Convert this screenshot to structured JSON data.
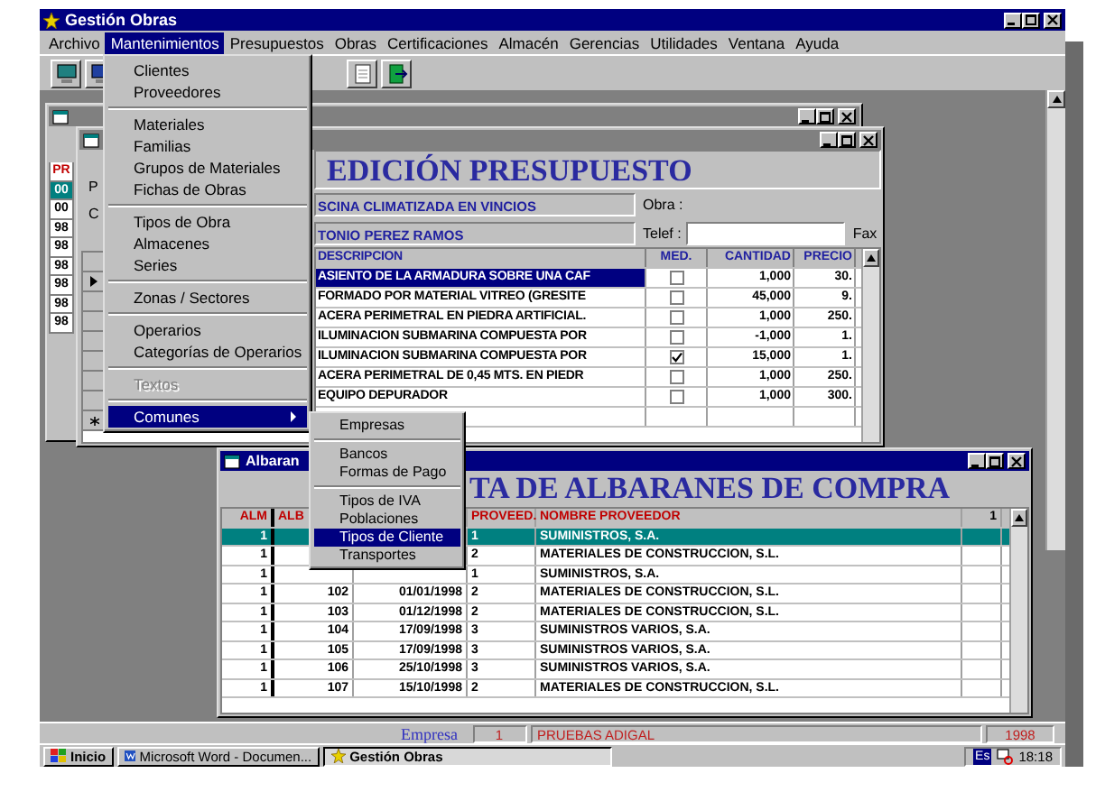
{
  "window": {
    "title": "Gestión Obras"
  },
  "menu_bar": [
    {
      "label": "Archivo",
      "selected": false
    },
    {
      "label": "Mantenimientos",
      "selected": true
    },
    {
      "label": "Presupuestos",
      "selected": false
    },
    {
      "label": "Obras",
      "selected": false
    },
    {
      "label": "Certificaciones",
      "selected": false
    },
    {
      "label": "Almacén",
      "selected": false
    },
    {
      "label": "Gerencias",
      "selected": false
    },
    {
      "label": "Utilidades",
      "selected": false
    },
    {
      "label": "Ventana",
      "selected": false
    },
    {
      "label": "Ayuda",
      "selected": false
    }
  ],
  "mantenimientos_menu": [
    {
      "kind": "item",
      "label": "Clientes",
      "disabled": false,
      "selected": false,
      "has_submenu": false
    },
    {
      "kind": "item",
      "label": "Proveedores",
      "disabled": false,
      "selected": false,
      "has_submenu": false
    },
    {
      "kind": "separator"
    },
    {
      "kind": "item",
      "label": "Materiales",
      "disabled": false,
      "selected": false,
      "has_submenu": false
    },
    {
      "kind": "item",
      "label": "Familias",
      "disabled": false,
      "selected": false,
      "has_submenu": false
    },
    {
      "kind": "item",
      "label": "Grupos de Materiales",
      "disabled": false,
      "selected": false,
      "has_submenu": false
    },
    {
      "kind": "item",
      "label": "Fichas de Obras",
      "disabled": false,
      "selected": false,
      "has_submenu": false
    },
    {
      "kind": "separator"
    },
    {
      "kind": "item",
      "label": "Tipos de Obra",
      "disabled": false,
      "selected": false,
      "has_submenu": false
    },
    {
      "kind": "item",
      "label": "Almacenes",
      "disabled": false,
      "selected": false,
      "has_submenu": false
    },
    {
      "kind": "item",
      "label": "Series",
      "disabled": false,
      "selected": false,
      "has_submenu": false
    },
    {
      "kind": "separator"
    },
    {
      "kind": "item",
      "label": "Zonas / Sectores",
      "disabled": false,
      "selected": false,
      "has_submenu": false
    },
    {
      "kind": "separator"
    },
    {
      "kind": "item",
      "label": "Operarios",
      "disabled": false,
      "selected": false,
      "has_submenu": false
    },
    {
      "kind": "item",
      "label": "Categorías de Operarios",
      "disabled": false,
      "selected": false,
      "has_submenu": false
    },
    {
      "kind": "separator"
    },
    {
      "kind": "item",
      "label": "Textos",
      "disabled": true,
      "selected": false,
      "has_submenu": false
    },
    {
      "kind": "separator"
    },
    {
      "kind": "item",
      "label": "Comunes",
      "disabled": false,
      "selected": true,
      "has_submenu": true
    }
  ],
  "comunes_submenu": [
    {
      "kind": "item",
      "label": "Empresas",
      "selected": false
    },
    {
      "kind": "separator"
    },
    {
      "kind": "item",
      "label": "Bancos",
      "selected": false
    },
    {
      "kind": "item",
      "label": "Formas de Pago",
      "selected": false
    },
    {
      "kind": "separator"
    },
    {
      "kind": "item",
      "label": "Tipos de IVA",
      "selected": false
    },
    {
      "kind": "item",
      "label": "Poblaciones",
      "selected": false
    },
    {
      "kind": "item",
      "label": "Tipos de Cliente",
      "selected": true
    },
    {
      "kind": "item",
      "label": "Transportes",
      "selected": false
    }
  ],
  "presupuestos_window": {
    "codes": [
      {
        "kind": "header",
        "text": "PR",
        "selected": false
      },
      {
        "kind": "code",
        "text": "00",
        "selected": true
      },
      {
        "kind": "code",
        "text": "00",
        "selected": false
      },
      {
        "kind": "code",
        "text": "98",
        "selected": false
      },
      {
        "kind": "code",
        "text": "98",
        "selected": false
      },
      {
        "kind": "code",
        "text": "98",
        "selected": false
      },
      {
        "kind": "code",
        "text": "98",
        "selected": false
      },
      {
        "kind": "code",
        "text": "98",
        "selected": false
      },
      {
        "kind": "code",
        "text": "98",
        "selected": false
      }
    ]
  },
  "edicion_window": {
    "heading": "EDICIÓN PRESUPUESTO",
    "labels": [
      "P",
      "C"
    ],
    "obra_value": "SCINA CLIMATIZADA EN VINCIOS",
    "obra_label": "Obra :",
    "cliente_value": "TONIO PEREZ RAMOS",
    "telef_label": "Telef :",
    "fax_label": "Fax",
    "record_selectors": [
      {
        "kind": "blank"
      },
      {
        "kind": "current"
      },
      {
        "kind": "blank"
      },
      {
        "kind": "blank"
      },
      {
        "kind": "blank"
      },
      {
        "kind": "blank"
      },
      {
        "kind": "blank"
      },
      {
        "kind": "blank"
      },
      {
        "kind": "new"
      }
    ],
    "table": {
      "columns": [
        "DESCRIPCION",
        "MED.",
        "CANTIDAD",
        "PRECIO"
      ],
      "rows": [
        {
          "descripcion": "ASIENTO DE LA ARMADURA SOBRE UNA CAF",
          "med": false,
          "cantidad": "1,000",
          "precio": "30.",
          "selected": true
        },
        {
          "descripcion": "FORMADO POR MATERIAL VITREO (GRESITE",
          "med": false,
          "cantidad": "45,000",
          "precio": "9.",
          "selected": false
        },
        {
          "descripcion": "ACERA PERIMETRAL EN PIEDRA ARTIFICIAL.",
          "med": false,
          "cantidad": "1,000",
          "precio": "250.",
          "selected": false
        },
        {
          "descripcion": "ILUMINACION SUBMARINA COMPUESTA POR",
          "med": false,
          "cantidad": "-1,000",
          "precio": "1.",
          "selected": false
        },
        {
          "descripcion": "ILUMINACION SUBMARINA COMPUESTA POR",
          "med": true,
          "cantidad": "15,000",
          "precio": "1.",
          "selected": false
        },
        {
          "descripcion": "ACERA PERIMETRAL DE 0,45 MTS. EN PIEDR",
          "med": false,
          "cantidad": "1,000",
          "precio": "250.",
          "selected": false
        },
        {
          "descripcion": "EQUIPO DEPURADOR",
          "med": false,
          "cantidad": "1,000",
          "precio": "300.",
          "selected": false
        }
      ]
    }
  },
  "albaranes_window": {
    "title": "Albaran",
    "heading": "TA DE ALBARANES DE COMPRA",
    "columns": [
      "ALM",
      "ALB",
      "PROVEED.",
      "NOMBRE PROVEEDOR",
      "1"
    ],
    "rows": [
      {
        "alm": "1",
        "proveed": "1",
        "nombre": "SUMINISTROS, S.A.",
        "selected": true
      },
      {
        "alm": "1",
        "proveed": "2",
        "nombre": "MATERIALES DE CONSTRUCCION, S.L.",
        "selected": false
      },
      {
        "alm": "1",
        "proveed": "1",
        "nombre": "SUMINISTROS, S.A.",
        "selected": false
      },
      {
        "alm": "1",
        "alb": "102",
        "fecha": "01/01/1998",
        "proveed": "2",
        "nombre": "MATERIALES DE CONSTRUCCION, S.L.",
        "selected": false
      },
      {
        "alm": "1",
        "alb": "103",
        "fecha": "01/12/1998",
        "proveed": "2",
        "nombre": "MATERIALES DE CONSTRUCCION, S.L.",
        "selected": false
      },
      {
        "alm": "1",
        "alb": "104",
        "fecha": "17/09/1998",
        "proveed": "3",
        "nombre": "SUMINISTROS VARIOS, S.A.",
        "selected": false
      },
      {
        "alm": "1",
        "alb": "105",
        "fecha": "17/09/1998",
        "proveed": "3",
        "nombre": "SUMINISTROS VARIOS, S.A.",
        "selected": false
      },
      {
        "alm": "1",
        "alb": "106",
        "fecha": "25/10/1998",
        "proveed": "3",
        "nombre": "SUMINISTROS VARIOS, S.A.",
        "selected": false
      },
      {
        "alm": "1",
        "alb": "107",
        "fecha": "15/10/1998",
        "proveed": "2",
        "nombre": "MATERIALES DE CONSTRUCCION, S.L.",
        "selected": false
      }
    ]
  },
  "status_bar": {
    "empresa_label": "Empresa",
    "empresa_code": "1",
    "empresa_name": "PRUEBAS ADIGAL",
    "year": "1998"
  },
  "taskbar": {
    "start": "Inicio",
    "tasks": [
      {
        "kind": "word",
        "label": "Microsoft Word - Documen...",
        "selected": false
      },
      {
        "kind": "app",
        "label": "Gestión Obras",
        "selected": true
      }
    ],
    "language": "Es",
    "clock": "18:18"
  }
}
